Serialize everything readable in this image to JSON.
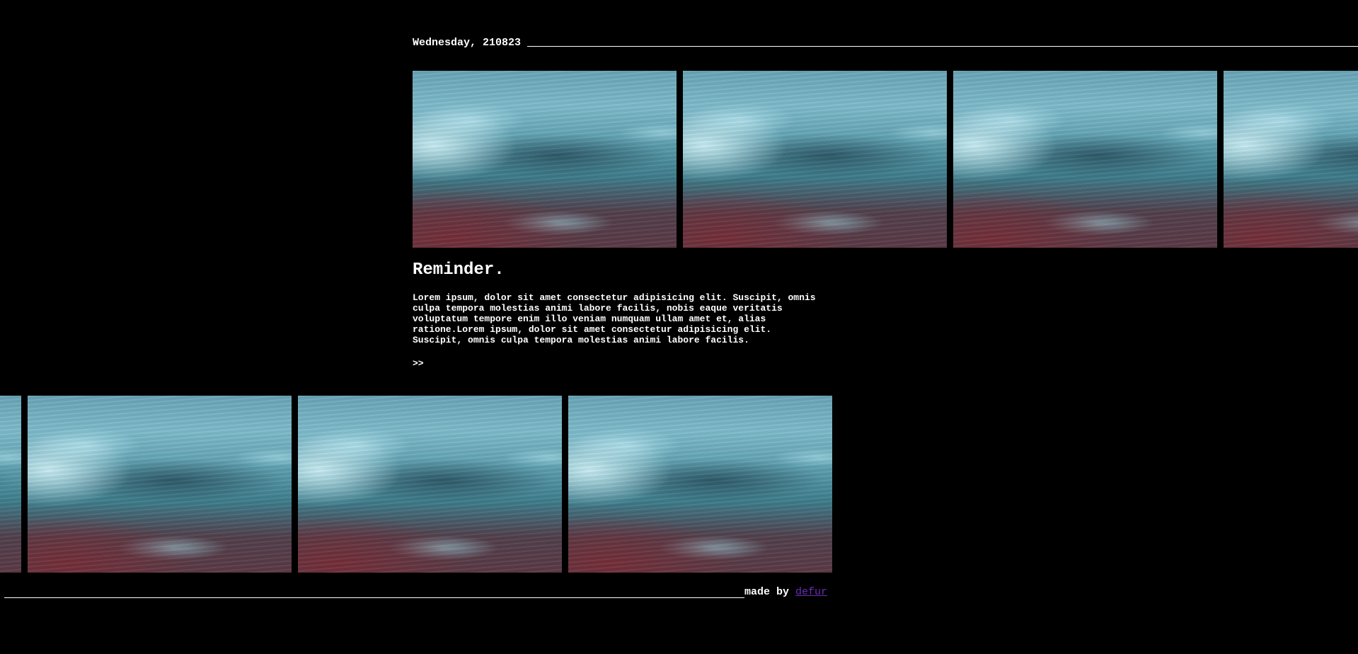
{
  "header": {
    "date": "Wednesday, 210823"
  },
  "gallery": {
    "image_subject": "ocean-wave-photo",
    "top_row_count": 4,
    "bottom_row_count": 4
  },
  "article": {
    "title": "Reminder.",
    "body": "Lorem ipsum, dolor sit amet consectetur adipisicing elit. Suscipit, omnis culpa tempora molestias animi labore facilis, nobis eaque veritatis voluptatum tempore enim illo veniam numquam ullam amet et, alias ratione.Lorem ipsum, dolor sit amet consectetur adipisicing elit. Suscipit, omnis culpa tempora molestias animi labore facilis.",
    "more_link": ">>"
  },
  "footer": {
    "made_by_label": "made by",
    "author_link": "defur"
  },
  "colors": {
    "background": "#000000",
    "text": "#ffffff",
    "author_link": "#6a2cb8"
  }
}
